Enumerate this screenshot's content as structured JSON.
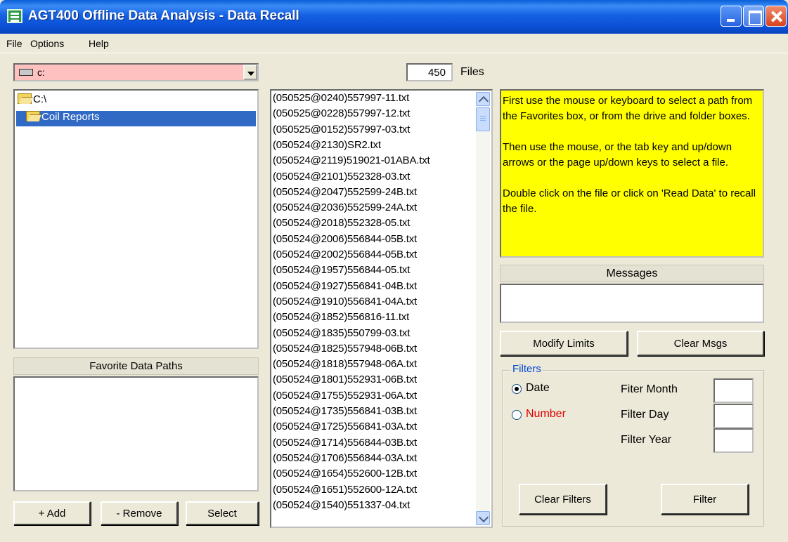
{
  "window": {
    "title": "AGT400 Offline Data Analysis - Data Recall"
  },
  "menu": {
    "items": [
      {
        "label": "File"
      },
      {
        "label": "Options"
      },
      {
        "label": "Help"
      }
    ]
  },
  "drive": {
    "value": "c:"
  },
  "folders": {
    "root": "C:\\",
    "selected": "Coil Reports"
  },
  "favorites": {
    "header": "Favorite Data Paths",
    "items": []
  },
  "buttons": {
    "add": "+ Add",
    "remove": "- Remove",
    "select": "Select",
    "modify_limits": "Modify Limits",
    "clear_msgs": "Clear Msgs",
    "clear_filters": "Clear Filters",
    "filter": "Filter"
  },
  "files": {
    "count": "450",
    "count_label": "Files",
    "items": [
      "(050525@0240)557997-11.txt",
      "(050525@0228)557997-12.txt",
      "(050525@0152)557997-03.txt",
      "(050524@2130)SR2.txt",
      "(050524@2119)519021-01ABA.txt",
      "(050524@2101)552328-03.txt",
      "(050524@2047)552599-24B.txt",
      "(050524@2036)552599-24A.txt",
      "(050524@2018)552328-05.txt",
      "(050524@2006)556844-05B.txt",
      "(050524@2002)556844-05B.txt",
      "(050524@1957)556844-05.txt",
      "(050524@1927)556841-04B.txt",
      "(050524@1910)556841-04A.txt",
      "(050524@1852)556816-11.txt",
      "(050524@1835)550799-03.txt",
      "(050524@1825)557948-06B.txt",
      "(050524@1818)557948-06A.txt",
      "(050524@1801)552931-06B.txt",
      "(050524@1755)552931-06A.txt",
      "(050524@1735)556841-03B.txt",
      "(050524@1725)556841-03A.txt",
      "(050524@1714)556844-03B.txt",
      "(050524@1706)556844-03A.txt",
      "(050524@1654)552600-12B.txt",
      "(050524@1651)552600-12A.txt",
      "(050524@1540)551337-04.txt"
    ]
  },
  "help": {
    "p1": "First use the mouse or keyboard to select a path from the Favorites box, or from the drive and folder boxes.",
    "p2": "Then use the mouse, or the tab key and up/down arrows or the page up/down keys to select a file.",
    "p3": "Double click on the file or click on 'Read Data' to recall the file."
  },
  "messages": {
    "header": "Messages",
    "text": ""
  },
  "filters": {
    "legend": "Filters",
    "date_label": "Date",
    "number_label": "Number",
    "selected": "Date",
    "month_label": "Fiter Month",
    "day_label": "Filter Day",
    "year_label": "Filter Year",
    "month_value": "",
    "day_value": "",
    "year_value": ""
  },
  "colors": {
    "title_bar": "#0b55d8",
    "drive_bg": "#ffc0c0",
    "help_bg": "#ffff00",
    "selection": "#316ac5",
    "number_label": "#e00000",
    "filters_legend": "#0046d5"
  }
}
